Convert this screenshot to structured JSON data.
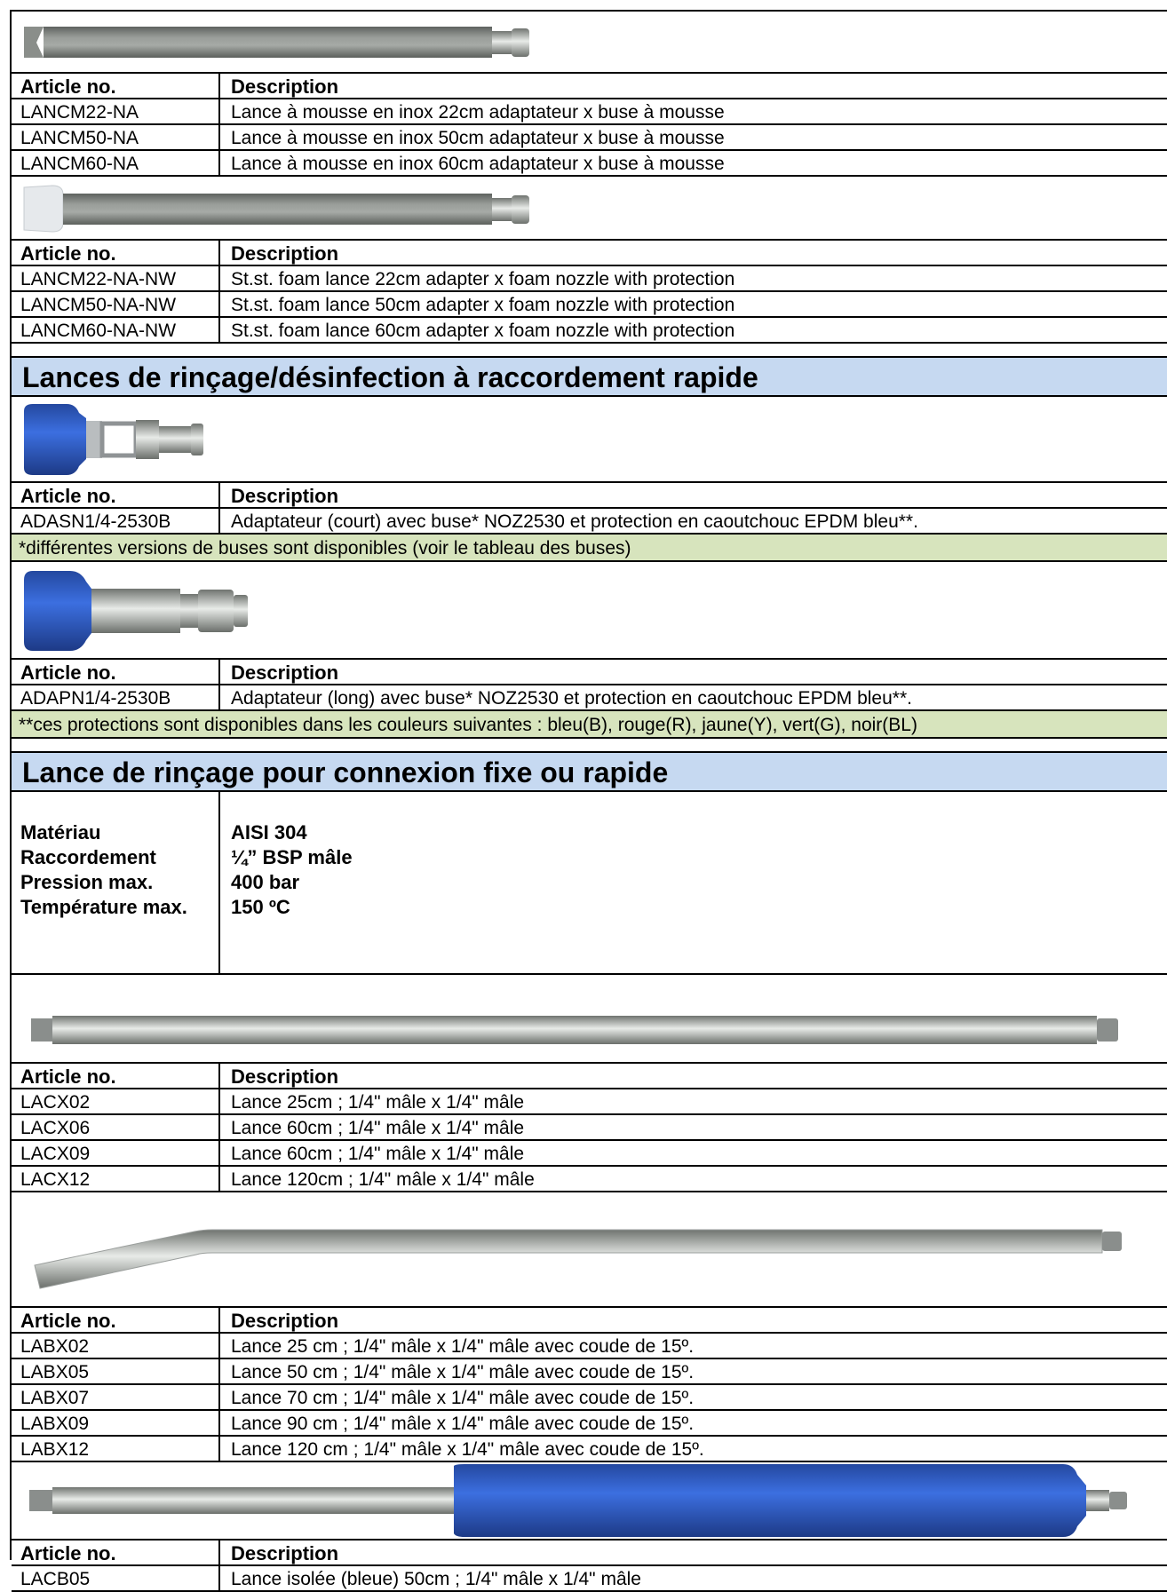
{
  "foam_lance": {
    "header": {
      "article": "Article no.",
      "description": "Description"
    },
    "rows": [
      {
        "article": "LANCM22-NA",
        "description": "Lance à mousse en inox 22cm adaptateur x buse à mousse"
      },
      {
        "article": "LANCM50-NA",
        "description": "Lance à mousse en inox 50cm adaptateur x buse à mousse"
      },
      {
        "article": "LANCM60-NA",
        "description": "Lance à mousse en inox 60cm adaptateur x buse à mousse"
      }
    ]
  },
  "foam_lance_protected": {
    "header": {
      "article": "Article no.",
      "description": "Description"
    },
    "rows": [
      {
        "article": "LANCM22-NA-NW",
        "description": "St.st. foam lance 22cm adapter x foam nozzle with protection"
      },
      {
        "article": "LANCM50-NA-NW",
        "description": "St.st. foam lance 50cm adapter x foam nozzle with protection"
      },
      {
        "article": "LANCM60-NA-NW",
        "description": "St.st. foam lance 60cm adapter x foam nozzle with protection"
      }
    ]
  },
  "section_quick": {
    "title": "Lances de rinçage/désinfection à raccordement rapide"
  },
  "adapter_short": {
    "header": {
      "article": "Article no.",
      "description": "Description"
    },
    "rows": [
      {
        "article": "ADASN1/4-2530B",
        "description": "Adaptateur (court) avec buse* NOZ2530 et protection en caoutchouc EPDM bleu**."
      }
    ],
    "note": "*différentes versions de buses sont disponibles (voir le tableau des buses)"
  },
  "adapter_long": {
    "header": {
      "article": "Article no.",
      "description": "Description"
    },
    "rows": [
      {
        "article": "ADAPN1/4-2530B",
        "description": "Adaptateur (long) avec buse* NOZ2530 et protection en caoutchouc EPDM bleu**."
      }
    ],
    "note": "**ces protections sont disponibles dans les couleurs suivantes : bleu(B), rouge(R), jaune(Y), vert(G), noir(BL)"
  },
  "section_fixed": {
    "title": "Lance de rinçage pour connexion fixe ou rapide"
  },
  "specs": [
    {
      "label": "Matériau",
      "value": "AISI 304"
    },
    {
      "label": "Raccordement",
      "value": "¼” BSP mâle"
    },
    {
      "label": "Pression max.",
      "value": "400 bar"
    },
    {
      "label": "Température max.",
      "value": "150 ºC"
    }
  ],
  "straight_lance": {
    "header": {
      "article": "Article no.",
      "description": "Description"
    },
    "rows": [
      {
        "article": "LACX02",
        "description": "Lance 25cm ; 1/4\" mâle x 1/4\" mâle"
      },
      {
        "article": "LACX06",
        "description": "Lance 60cm ; 1/4\" mâle x 1/4\" mâle"
      },
      {
        "article": "LACX09",
        "description": "Lance 60cm ; 1/4\" mâle x 1/4\" mâle"
      },
      {
        "article": "LACX12",
        "description": "Lance 120cm ; 1/4\" mâle x 1/4\" mâle"
      }
    ]
  },
  "bent_lance": {
    "header": {
      "article": "Article no.",
      "description": "Description"
    },
    "rows": [
      {
        "article": "LABX02",
        "description": "Lance 25 cm ; 1/4\" mâle x 1/4\" mâle avec coude de 15º."
      },
      {
        "article": "LABX05",
        "description": "Lance 50 cm ; 1/4\" mâle x 1/4\" mâle avec coude de 15º."
      },
      {
        "article": "LABX07",
        "description": "Lance 70 cm ; 1/4\" mâle x 1/4\" mâle avec coude de 15º."
      },
      {
        "article": "LABX09",
        "description": "Lance 90 cm ; 1/4\" mâle x 1/4\" mâle avec coude de 15º."
      },
      {
        "article": "LABX12",
        "description": "Lance 120 cm ; 1/4\" mâle x 1/4\" mâle avec coude de 15º."
      }
    ]
  },
  "insulated_lance": {
    "header": {
      "article": "Article no.",
      "description": "Description"
    },
    "rows": [
      {
        "article": "LACB05",
        "description": "Lance isolée (bleue) 50cm ; 1/4\" mâle x 1/4\" mâle"
      }
    ]
  },
  "colors": {
    "section_bg": "#c6d9f1",
    "note_bg": "#d7e4bd",
    "protection_blue": "#2f5fc4"
  }
}
